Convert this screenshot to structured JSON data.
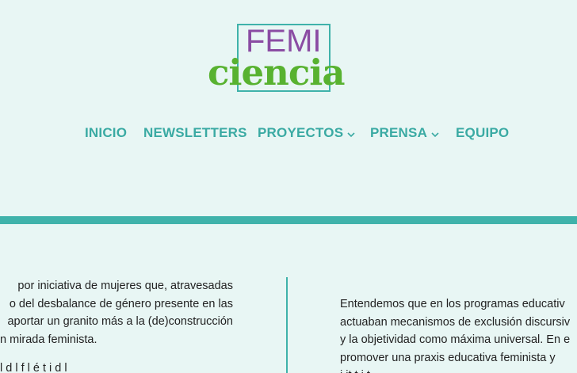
{
  "logo": {
    "top_text": "FEMI",
    "bottom_text": "ciencia"
  },
  "nav": {
    "items": [
      {
        "label": "INICIO",
        "has_dropdown": false
      },
      {
        "label": "NEWSLETTERS",
        "has_dropdown": false
      },
      {
        "label": "PROYECTOS",
        "has_dropdown": true
      },
      {
        "label": "PRENSA",
        "has_dropdown": true
      },
      {
        "label": "EQUIPO",
        "has_dropdown": false
      }
    ]
  },
  "content": {
    "left_lines": [
      "por iniciativa de mujeres que, atravesadas",
      "o del desbalance de género presente en las",
      "aportar un granito más a la (de)construcción",
      "n mirada feminista.",
      "l      d      l        f                      l        é  t i        d  l"
    ],
    "right_lines": [
      "Entendemos que en los programas educativ",
      "actuaban mecanismos de exclusión discursiv",
      "y la objetividad como máxima universal. En e",
      "promover una praxis educativa feminista y",
      "i  it                    t        i  t"
    ]
  },
  "colors": {
    "background": "#e8f6f4",
    "teal": "#3fb2aa",
    "nav_text": "#3aaaa3",
    "logo_purple": "#8a4ca3",
    "logo_green": "#58b230",
    "body_text": "#222222"
  }
}
